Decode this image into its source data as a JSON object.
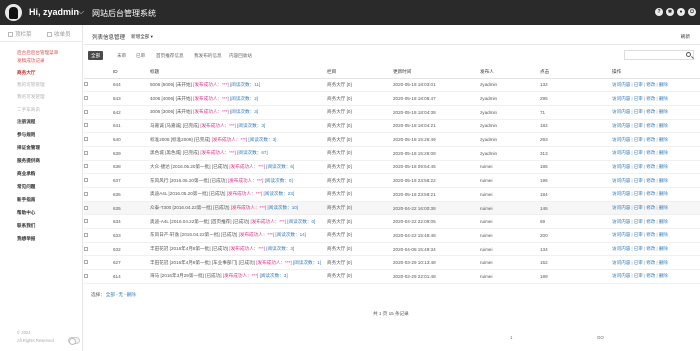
{
  "header": {
    "greeting": "Hi, zyadmin",
    "system_title": "网站后台管理系统",
    "icons": [
      "help-icon",
      "settings-icon",
      "user-icon",
      "logout-icon"
    ]
  },
  "sidebar": {
    "tabs": [
      {
        "label": "顶栏菜"
      },
      {
        "label": "收单员"
      }
    ],
    "items": [
      {
        "label": "后台后后台管理菜单",
        "style": "red"
      },
      {
        "label": "发稿成功记录",
        "style": "red"
      },
      {
        "label": "商务大厅",
        "style": "redbold"
      },
      {
        "label": "我的可管管理",
        "style": "grey"
      },
      {
        "label": "我的可发管理",
        "style": "grey"
      },
      {
        "label": "二手车商讯",
        "style": "grey"
      },
      {
        "label": "注册流程",
        "style": "bold"
      },
      {
        "label": "参与规则",
        "style": "bold"
      },
      {
        "label": "择证金管理",
        "style": "bold"
      },
      {
        "label": "服务提供商",
        "style": "bold"
      },
      {
        "label": "商业承购",
        "style": "bold"
      },
      {
        "label": "常见问题",
        "style": "bold"
      },
      {
        "label": "新手指南",
        "style": "bold"
      },
      {
        "label": "帮助中心",
        "style": "bold"
      },
      {
        "label": "联系我们",
        "style": "bold"
      },
      {
        "label": "我想举报",
        "style": "bold"
      }
    ],
    "footer_year": "© 2024",
    "footer_rights": "All Rights Reserved"
  },
  "main": {
    "title": "列表信息管理",
    "subtitle": "新增全部 ▾",
    "refresh": "刷新",
    "filters": [
      {
        "label": "全部",
        "active": true
      },
      {
        "label": "未审",
        "active": false
      },
      {
        "label": "已审",
        "active": false
      },
      {
        "label": "首页推荐信息",
        "active": false
      },
      {
        "label": "我发布的信息",
        "active": false
      },
      {
        "label": "内容回收站",
        "active": false
      }
    ],
    "columns": [
      "",
      "ID",
      "标题",
      "栏目",
      "更新时间",
      "发布人",
      "点击",
      "操作"
    ],
    "rows": [
      {
        "id": "644",
        "t1": "5006",
        "t2": "[5006] [未开始]",
        "t3": "[发布成功人：***]",
        "t4": "[阅读次数：11]",
        "col": "商务大厅 [0]",
        "time": "2020-05-18 18:03:01",
        "user": "zyadmin",
        "clicks": "132"
      },
      {
        "id": "643",
        "t1": "4006",
        "t2": "[4006] [未开始]",
        "t3": "[发布成功人：***]",
        "t4": "[阅读次数：2]",
        "col": "商务大厅 [0]",
        "time": "2020-05-18 18:06:47",
        "user": "zyadmin",
        "clicks": "295"
      },
      {
        "id": "642",
        "t1": "3006",
        "t2": "[3006] [未开始]",
        "t3": "[发布成功人：***]",
        "t4": "[阅读次数：3]",
        "col": "商务大厅 [0]",
        "time": "2020-05-18 18:04:38",
        "user": "zyadmin",
        "clicks": "71"
      },
      {
        "id": "641",
        "t1": "马嘉诚",
        "t2": "[马嘉诚] [已完成]",
        "t3": "[发布成功人：***]",
        "t4": "[阅读次数：3]",
        "col": "商务大厅 [0]",
        "time": "2020-05-18 18:04:21",
        "user": "zyadmin",
        "clicks": "182"
      },
      {
        "id": "640",
        "t1": "标准2008",
        "t2": "[标准2008] [已完成]",
        "t3": "[发布成功人：***]",
        "t4": "[阅读次数：3]",
        "col": "商务大厅 [0]",
        "time": "2020-05-18 15:26:49",
        "user": "zyadmin",
        "clicks": "293"
      },
      {
        "id": "639",
        "t1": "黑色城",
        "t2": "[黑色城] [已完成]",
        "t3": "[发布成功人：***]",
        "t4": "[阅读次数：67]",
        "col": "商务大厅 [0]",
        "time": "2020-05-18 15:26:09",
        "user": "zyadmin",
        "clicks": "313"
      },
      {
        "id": "638",
        "t1": "大众-捷达",
        "t2": "[2016.05.20第一批] [已成功]",
        "t3": "[发布成功人：***]",
        "t4": "[阅读次数：6]",
        "col": "商务大厅 [0]",
        "time": "2020-05-18 09:54:45",
        "user": "ruimei",
        "clicks": "185"
      },
      {
        "id": "637",
        "t1": "东风风行",
        "t2": "[2016.05.20第一批] [已成功]",
        "t3": "[发布成功人：***]",
        "t4": "[阅读次数：0]",
        "col": "商务大厅 [0]",
        "time": "2020-05-18 23:58:22",
        "user": "ruimei",
        "clicks": "195"
      },
      {
        "id": "636",
        "t1": "奥迪A4L",
        "t2": "[2016.05.20第一批] [已成功]",
        "t3": "[发布成功人：***]",
        "t4": "[阅读次数：23]",
        "col": "商务大厅 [0]",
        "time": "2020-05-18 23:58:21",
        "user": "ruimei",
        "clicks": "184"
      },
      {
        "id": "635",
        "t1": "众泰-T300",
        "t2": "[2016.04.22第一批] [已成功]",
        "t3": "[发布成功人：***]",
        "t4": "[阅读次数：10]",
        "col": "商务大厅 [0]",
        "time": "2020-04-22 16:00:38",
        "user": "ruimei",
        "clicks": "146",
        "hl": true
      },
      {
        "id": "634",
        "t1": "奥迪-A4L",
        "t2": "[2016.04.22第一批] [首页推荐] [已成功]",
        "t3": "[发布成功人：***]",
        "t4": "[阅读次数：0]",
        "col": "商务大厅 [0]",
        "time": "2020-04-22 22:09:05",
        "user": "ruimei",
        "clicks": "69"
      },
      {
        "id": "633",
        "t1": "东风日产-轩逸",
        "t2": "[2016.04.22第一批] [已成功]",
        "t3": "[发布成功人：***]",
        "t4": "[阅读次数：14]",
        "col": "商务大厅 [0]",
        "time": "2020-04-22 15:49:48",
        "user": "ruimei",
        "clicks": "200"
      },
      {
        "id": "632",
        "t1": "丰田花冠",
        "t2": "[2016年4月8第一批] [已成功]",
        "t3": "[发布成功人：***]",
        "t4": "[阅读次数：3]",
        "col": "商务大厅 [0]",
        "time": "2020-04-08 15:49:34",
        "user": "ruimei",
        "clicks": "134"
      },
      {
        "id": "627",
        "t1": "丰田花冠",
        "t2": "[2016年4月8第一批] [车业事部门] [已成功]",
        "t3": "[发布成功人：***]",
        "t4": "[阅读次数：1]",
        "col": "商务大厅 [0]",
        "time": "2020-03-29 10:13:48",
        "user": "ruimei",
        "clicks": "152"
      },
      {
        "id": "614",
        "t1": "海马",
        "t2": "[2016年3月29第一批] [已成功]",
        "t3": "[发布成功人：***]",
        "t4": "[阅读次数：3]",
        "col": "商务大厅 [0]",
        "time": "2020-03-29 22:01:48",
        "user": "ruimei",
        "clicks": "189"
      }
    ],
    "row_ops": [
      "访问内容",
      "已审",
      "修改",
      "删除"
    ],
    "bulk": {
      "label": "选择：",
      "all": "全部",
      "none": "无",
      "delete": "删除"
    },
    "pagination": "共 1 页 15 条记录",
    "page_input": "1",
    "goto": "GO"
  }
}
